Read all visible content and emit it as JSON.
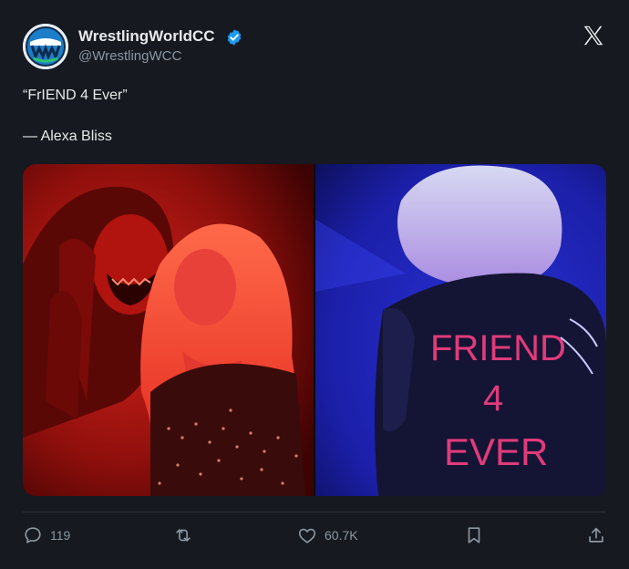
{
  "tweet": {
    "author_name": "WrestlingWorldCC",
    "author_handle": "@WrestlingWCC",
    "avatar_icon": "wrestling-world-logo",
    "verified_icon": "verified-badge-icon",
    "brand_icon": "x-logo-icon",
    "text_lines": [
      "“FrIEND 4 Ever”",
      "— Alexa Bliss"
    ],
    "media": {
      "description_panels": [
        "left-panel-red-tinted-photo",
        "right-panel-blue-tinted-photo"
      ],
      "jacket_text": [
        "FRIEND",
        "4",
        "EVER"
      ]
    },
    "actions": {
      "reply": {
        "icon": "reply-icon",
        "count": "119"
      },
      "retweet": {
        "icon": "retweet-icon",
        "count": ""
      },
      "like": {
        "icon": "heart-icon",
        "count": "60.7K"
      },
      "bookmark": {
        "icon": "bookmark-icon"
      },
      "share": {
        "icon": "share-icon"
      }
    }
  },
  "colors": {
    "background": "#16191f",
    "text_primary": "#e7e9ea",
    "text_secondary": "#8b98a5",
    "verified_blue": "#1d9bf0"
  }
}
